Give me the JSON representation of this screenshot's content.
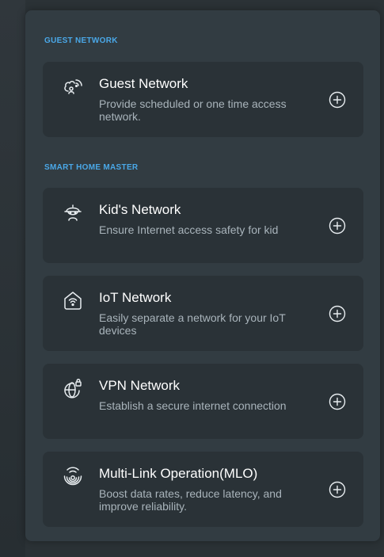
{
  "sections": {
    "guest": {
      "label": "GUEST NETWORK"
    },
    "smart_home": {
      "label": "SMART HOME MASTER"
    }
  },
  "cards": [
    {
      "icon": "guest-network-icon",
      "title": "Guest Network",
      "description": "Provide scheduled or one time access network."
    },
    {
      "icon": "kids-network-icon",
      "title": "Kid's Network",
      "description": "Ensure Internet access safety for kid"
    },
    {
      "icon": "iot-network-icon",
      "title": "IoT Network",
      "description": "Easily separate a network for your IoT devices"
    },
    {
      "icon": "vpn-network-icon",
      "title": "VPN Network",
      "description": "Establish a secure internet connection"
    },
    {
      "icon": "mlo-icon",
      "title": "Multi-Link Operation(MLO)",
      "description": "Boost data rates, reduce latency, and improve reliability."
    }
  ],
  "colors": {
    "accent": "#4aa8e8",
    "panel": "#323c42",
    "card": "#2a3237",
    "title": "#ffffff",
    "description": "#a9b4bb"
  }
}
